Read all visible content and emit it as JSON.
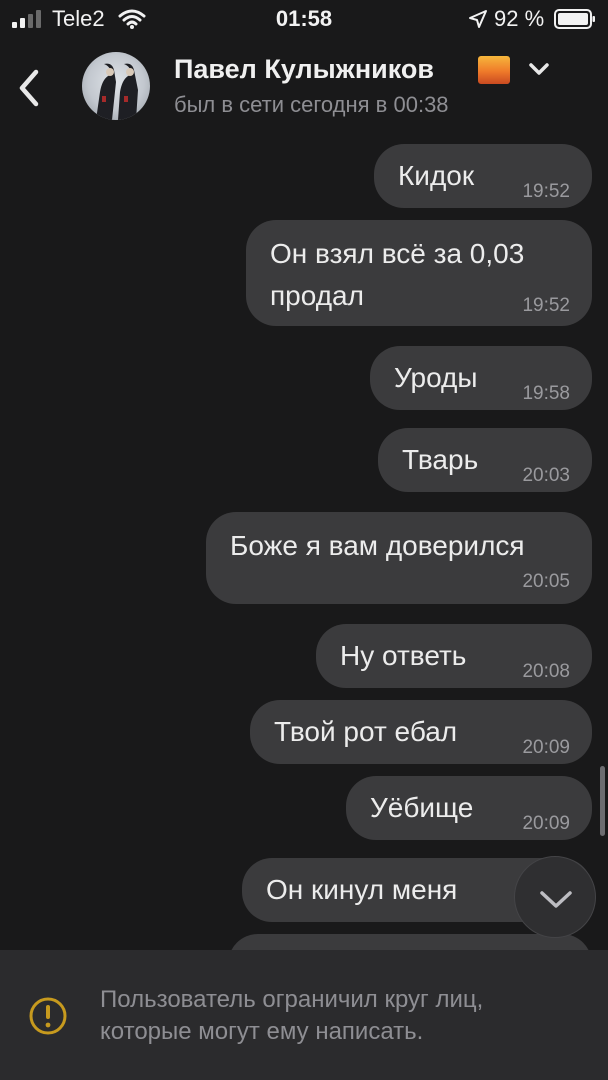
{
  "status_bar": {
    "carrier": "Tele2",
    "time": "01:58",
    "battery": "92 %",
    "icons": [
      "signal-icon",
      "wifi-icon",
      "location-arrow-icon",
      "battery-icon"
    ]
  },
  "header": {
    "back_icon": "chevron-left-icon",
    "contact_name": "Павел Кулыжников",
    "status": "был в сети сегодня в 00:38",
    "name_emoji": "sunrise-emoji",
    "dropdown_icon": "chevron-down-icon"
  },
  "messages": [
    {
      "text": "Кидок",
      "time": "19:52"
    },
    {
      "text_lines": [
        "Он взял всё за 0,03",
        "продал"
      ],
      "time": "19:52"
    },
    {
      "text": "Уроды",
      "time": "19:58"
    },
    {
      "text": "Тварь",
      "time": "20:03"
    },
    {
      "text": "Боже я вам доверился",
      "time": "20:05"
    },
    {
      "text": "Ну ответь",
      "time": "20:08"
    },
    {
      "text": "Твой рот ебал",
      "time": "20:09"
    },
    {
      "text": "Уёбище",
      "time": "20:09"
    },
    {
      "text": "Он кинул меня",
      "time": ""
    }
  ],
  "scroll_down_icon": "chevron-down-icon",
  "footer": {
    "icon": "warning-circle-icon",
    "notice": "Пользователь ограничил круг лиц, которые могут ему написать.",
    "colors": {
      "warning": "#c79a1e"
    }
  },
  "colors": {
    "background": "#19191a",
    "bubble": "#3b3b3d",
    "footer": "#2b2b2d"
  }
}
